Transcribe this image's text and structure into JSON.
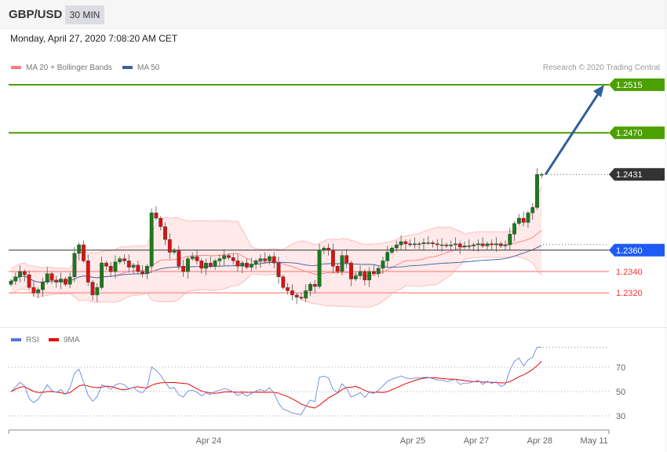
{
  "header": {
    "symbol": "GBP/USD",
    "timeframe": "30 MIN",
    "datetime": "Monday, April 27, 2020 7:08:20 AM CET"
  },
  "legend": {
    "ma20": "MA 20 + Bollinger Bands",
    "ma50": "MA 50",
    "rsi": "RSI",
    "rsi_ma": "9MA",
    "copyright": "Research © 2020 Trading Central"
  },
  "colors": {
    "up": "#1a7a1a",
    "down": "#d11",
    "band": "#ffe3e3",
    "ma50": "#3a5ea8",
    "target": "#4ca000",
    "pivot": "#1f5af5",
    "support": "#ff3333",
    "last": "#333333",
    "arrow": "#2f5ea0"
  },
  "chart_data": {
    "type": "candlestick",
    "price_range": [
      1.229,
      1.2525
    ],
    "levels": [
      {
        "label": "1.2515",
        "value": 1.2515,
        "kind": "target"
      },
      {
        "label": "1.2470",
        "value": 1.247,
        "kind": "target"
      },
      {
        "label": "1.2431",
        "value": 1.2431,
        "kind": "last"
      },
      {
        "label": "1.2360",
        "value": 1.236,
        "kind": "pivot"
      },
      {
        "label": "1.2340",
        "value": 1.234,
        "kind": "support"
      },
      {
        "label": "1.2320",
        "value": 1.232,
        "kind": "support"
      }
    ],
    "closes": [
      1.2331,
      1.2335,
      1.234,
      1.2337,
      1.2325,
      1.232,
      1.2323,
      1.233,
      1.2338,
      1.2332,
      1.233,
      1.2333,
      1.2328,
      1.2335,
      1.2357,
      1.2365,
      1.235,
      1.233,
      1.2318,
      1.2325,
      1.2348,
      1.2345,
      1.234,
      1.2349,
      1.2352,
      1.235,
      1.2344,
      1.2346,
      1.234,
      1.2338,
      1.2345,
      1.2395,
      1.239,
      1.2382,
      1.237,
      1.2358,
      1.236,
      1.2345,
      1.234,
      1.2352,
      1.2354,
      1.235,
      1.2343,
      1.2348,
      1.2345,
      1.235,
      1.2352,
      1.2355,
      1.2353,
      1.235,
      1.2345,
      1.2348,
      1.2344,
      1.2347,
      1.235,
      1.2352,
      1.235,
      1.2354,
      1.2348,
      1.2335,
      1.2325,
      1.2322,
      1.2318,
      1.2316,
      1.2315,
      1.2322,
      1.2328,
      1.2326,
      1.236,
      1.2362,
      1.236,
      1.2345,
      1.234,
      1.2355,
      1.2348,
      1.2333,
      1.2336,
      1.234,
      1.2332,
      1.234,
      1.2338,
      1.2343,
      1.235,
      1.2358,
      1.2362,
      1.2365,
      1.2368,
      1.2366,
      1.2365,
      1.2366,
      1.2366,
      1.2367,
      1.2367,
      1.2366,
      1.2365,
      1.2365,
      1.2364,
      1.2365,
      1.2366,
      1.2363,
      1.2364,
      1.2364,
      1.2365,
      1.2366,
      1.2364,
      1.2366,
      1.2365,
      1.2366,
      1.2364,
      1.2365,
      1.2375,
      1.2385,
      1.239,
      1.2386,
      1.2395,
      1.24,
      1.2431,
      1.2431
    ],
    "forecast": {
      "from": 1.2431,
      "to": 1.2515
    },
    "rsi_levels": [
      {
        "label": "70",
        "value": 70
      },
      {
        "label": "50",
        "value": 50
      },
      {
        "label": "30",
        "value": 30
      }
    ],
    "x_ticks": [
      {
        "label": "Apr 24",
        "index": 46
      },
      {
        "label": "Apr 25",
        "index": 91
      },
      {
        "label": "Apr 27",
        "index": 105
      },
      {
        "label": "Apr 28",
        "index": 119
      },
      {
        "label": "May 11",
        "index": 131
      }
    ]
  }
}
